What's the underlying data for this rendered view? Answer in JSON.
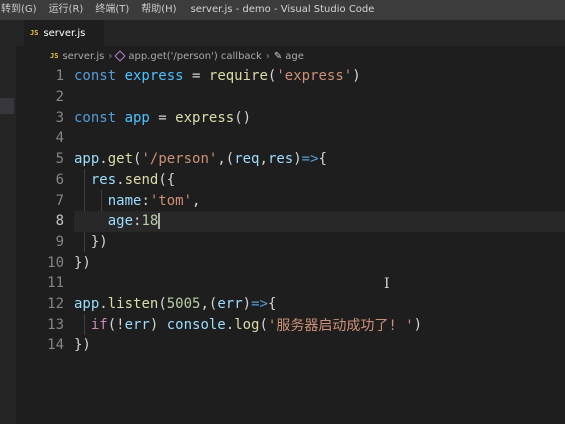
{
  "menu": [
    "转到(G)",
    "运行(R)",
    "终端(T)",
    "帮助(H)"
  ],
  "window_title": "server.js - demo - Visual Studio Code",
  "tab": {
    "badge": "JS",
    "label": "server.js"
  },
  "breadcrumbs": {
    "badge": "JS",
    "file": "server.js",
    "callback": "app.get('/person') callback",
    "property": "age"
  },
  "editor": {
    "current_line": 8,
    "lines": [
      {
        "n": "1",
        "tokens": [
          [
            "const ",
            "kw"
          ],
          [
            "express",
            "var"
          ],
          [
            " = ",
            "op"
          ],
          [
            "require",
            "fn"
          ],
          [
            "(",
            "punc"
          ],
          [
            "'express'",
            "str"
          ],
          [
            ")",
            "punc"
          ]
        ]
      },
      {
        "n": "2",
        "tokens": []
      },
      {
        "n": "3",
        "tokens": [
          [
            "const ",
            "kw"
          ],
          [
            "app",
            "var"
          ],
          [
            " = ",
            "op"
          ],
          [
            "express",
            "fn"
          ],
          [
            "()",
            "punc"
          ]
        ]
      },
      {
        "n": "4",
        "tokens": []
      },
      {
        "n": "5",
        "tokens": [
          [
            "app",
            "ident"
          ],
          [
            ".",
            "punc"
          ],
          [
            "get",
            "fn"
          ],
          [
            "(",
            "punc"
          ],
          [
            "'/person'",
            "str"
          ],
          [
            ",",
            "punc"
          ],
          [
            "(",
            "punc"
          ],
          [
            "req",
            "param"
          ],
          [
            ",",
            "punc"
          ],
          [
            "res",
            "param"
          ],
          [
            ")",
            "punc"
          ],
          [
            "=>",
            "kw"
          ],
          [
            "{",
            "punc"
          ]
        ]
      },
      {
        "n": "6",
        "tokens": [
          [
            "  ",
            "punc"
          ],
          [
            "res",
            "ident"
          ],
          [
            ".",
            "punc"
          ],
          [
            "send",
            "fn"
          ],
          [
            "(",
            "punc"
          ],
          [
            "{",
            "punc"
          ]
        ]
      },
      {
        "n": "7",
        "tokens": [
          [
            "    ",
            "punc"
          ],
          [
            "name",
            "prop"
          ],
          [
            ":",
            "punc"
          ],
          [
            "'tom'",
            "str"
          ],
          [
            ",",
            "punc"
          ]
        ]
      },
      {
        "n": "8",
        "tokens": [
          [
            "    ",
            "punc"
          ],
          [
            "age",
            "prop"
          ],
          [
            ":",
            "punc"
          ],
          [
            "18",
            "num"
          ]
        ]
      },
      {
        "n": "9",
        "tokens": [
          [
            "  ",
            "punc"
          ],
          [
            "}",
            "punc"
          ],
          [
            ")",
            "punc"
          ]
        ]
      },
      {
        "n": "10",
        "tokens": [
          [
            "})",
            "punc"
          ]
        ]
      },
      {
        "n": "11",
        "tokens": []
      },
      {
        "n": "12",
        "tokens": [
          [
            "app",
            "ident"
          ],
          [
            ".",
            "punc"
          ],
          [
            "listen",
            "fn"
          ],
          [
            "(",
            "punc"
          ],
          [
            "5005",
            "num"
          ],
          [
            ",",
            "punc"
          ],
          [
            "(",
            "punc"
          ],
          [
            "err",
            "param"
          ],
          [
            ")",
            "punc"
          ],
          [
            "=>",
            "kw"
          ],
          [
            "{",
            "punc"
          ]
        ]
      },
      {
        "n": "13",
        "tokens": [
          [
            "  ",
            "punc"
          ],
          [
            "if",
            "kw2"
          ],
          [
            "(!",
            "punc"
          ],
          [
            "err",
            "ident"
          ],
          [
            ") ",
            "punc"
          ],
          [
            "console",
            "ident"
          ],
          [
            ".",
            "punc"
          ],
          [
            "log",
            "fn"
          ],
          [
            "(",
            "punc"
          ],
          [
            "'服务器启动成功了! '",
            "str"
          ],
          [
            ")",
            "punc"
          ]
        ]
      },
      {
        "n": "14",
        "tokens": [
          [
            "})",
            "punc"
          ]
        ]
      }
    ]
  },
  "colors": {
    "titlebar": "#3c3c3c",
    "editor_bg": "#1e1e1e",
    "keyword": "#569cd6",
    "string": "#ce9178",
    "function": "#dcdcaa",
    "number": "#b5cea8"
  }
}
